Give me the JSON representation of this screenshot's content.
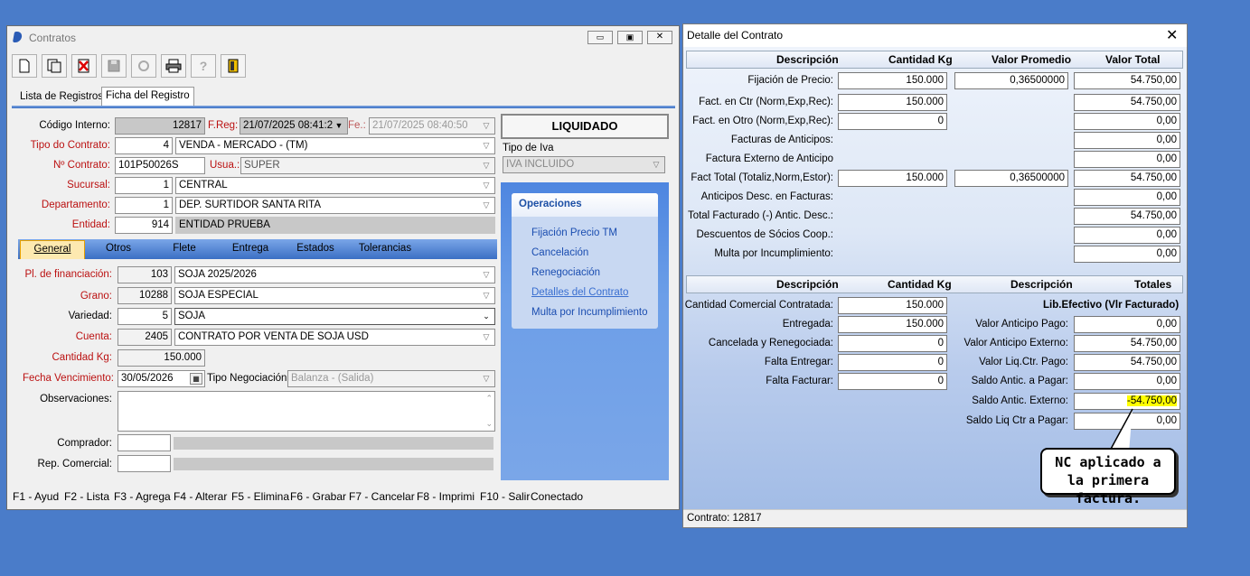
{
  "contratos": {
    "title": "Contratos",
    "tabs": [
      "Lista de Registros",
      "Ficha del Registro"
    ],
    "labels": {
      "codigo": "Código Interno:",
      "freg": "F.Reg:",
      "fe": "Fe.:",
      "tipo_contrato": "Tipo do Contrato:",
      "nro_contrato": "Nº Contrato:",
      "usua": "Usua.:",
      "sucursal": "Sucursal:",
      "departamento": "Departamento:",
      "entidad": "Entidad:",
      "tipo_iva": "Tipo de Iva"
    },
    "values": {
      "codigo": "12817",
      "freg": "21/07/2025 08:41:2",
      "fe": "21/07/2025 08:40:50",
      "tipo_contrato_code": "4",
      "tipo_contrato": "VENDA - MERCADO - (TM)",
      "nro_contrato": "101P50026S",
      "usua": "SUPER",
      "sucursal_code": "1",
      "sucursal": "CENTRAL",
      "departamento_code": "1",
      "departamento": "DEP. SURTIDOR SANTA RITA",
      "entidad_code": "914",
      "entidad": "ENTIDAD PRUEBA",
      "status": "LIQUIDADO",
      "tipo_iva": "IVA INCLUIDO"
    },
    "subtabs": [
      "General",
      "Otros",
      "Flete",
      "Entrega",
      "Estados",
      "Tolerancias"
    ],
    "general": {
      "labels": {
        "pl_fin": "Pl. de financiación:",
        "grano": "Grano:",
        "variedad": "Variedad:",
        "cuenta": "Cuenta:",
        "cantidad": "Cantidad Kg:",
        "fecha_venc": "Fecha Vencimiento:",
        "tipo_neg": "Tipo Negociación:",
        "obs": "Observaciones:",
        "comprador": "Comprador:",
        "rep": "Rep. Comercial:"
      },
      "values": {
        "pl_fin_code": "103",
        "pl_fin": "SOJA 2025/2026",
        "grano_code": "10288",
        "grano": "SOJA ESPECIAL",
        "variedad_code": "5",
        "variedad": "SOJA",
        "cuenta_code": "2405",
        "cuenta": "CONTRATO POR VENTA DE SOJA USD",
        "cantidad": "150.000",
        "fecha_venc": "30/05/2026",
        "tipo_neg": "Balanza - (Salida)"
      }
    },
    "operaciones": {
      "title": "Operaciones",
      "items": [
        "Fijación Precio TM",
        "Cancelación",
        "Renegociación",
        "Detalles del Contrato",
        "Multa por Incumplimiento"
      ]
    },
    "statusbar": [
      "F1 - Ayud",
      "F2 - Lista",
      "F3 - Agrega",
      "F4 - Alterar",
      "F5 - Elimina",
      "F6 - Grabar",
      "F7 - Cancelar",
      "F8 - Imprimi",
      "F10 - Salir",
      "Conectado"
    ]
  },
  "detalle": {
    "title": "Detalle del Contrato",
    "close": "✕",
    "top_headers": [
      "Descripción",
      "Cantidad Kg",
      "Valor Promedio",
      "Valor Total"
    ],
    "top_rows": [
      {
        "label": "Fijación de Precio:",
        "qty": "150.000",
        "avg": "0,36500000",
        "total": "54.750,00"
      },
      {
        "label": "Fact. en Ctr (Norm,Exp,Rec):",
        "qty": "150.000",
        "avg": null,
        "total": "54.750,00"
      },
      {
        "label": "Fact. en Otro (Norm,Exp,Rec):",
        "qty": "0",
        "avg": null,
        "total": "0,00"
      },
      {
        "label": "Facturas de Anticipos:",
        "qty": null,
        "avg": null,
        "total": "0,00"
      },
      {
        "label": "Factura Externo de Anticipo",
        "qty": null,
        "avg": null,
        "total": "0,00"
      },
      {
        "label": "Fact Total (Totaliz,Norm,Estor):",
        "qty": "150.000",
        "avg": "0,36500000",
        "total": "54.750,00"
      },
      {
        "label": "Anticipos Desc. en Facturas:",
        "qty": null,
        "avg": null,
        "total": "0,00"
      },
      {
        "label": "Total Facturado (-) Antic. Desc.:",
        "qty": null,
        "avg": null,
        "total": "54.750,00"
      },
      {
        "label": "Descuentos de Sócios Coop.:",
        "qty": null,
        "avg": null,
        "total": "0,00"
      },
      {
        "label": "Multa por Incumplimiento:",
        "qty": null,
        "avg": null,
        "total": "0,00"
      }
    ],
    "bottom_headers": [
      "Descripción",
      "Cantidad Kg",
      "Descripción",
      "Totales"
    ],
    "bottom_left": [
      {
        "label": "Cantidad Comercial Contratada:",
        "qty": "150.000"
      },
      {
        "label": "Entregada:",
        "qty": "150.000"
      },
      {
        "label": "Cancelada y Renegociada:",
        "qty": "0"
      },
      {
        "label": "Falta Entregar:",
        "qty": "0"
      },
      {
        "label": "Falta Facturar:",
        "qty": "0"
      }
    ],
    "lib_title": "Lib.Efectivo (Vlr Facturado)",
    "bottom_right": [
      {
        "label": "Valor Anticipo Pago:",
        "value": "0,00"
      },
      {
        "label": "Valor Anticipo Externo:",
        "value": "54.750,00"
      },
      {
        "label": "Valor Liq.Ctr. Pago:",
        "value": "54.750,00"
      },
      {
        "label": "Saldo Antic. a Pagar:",
        "value": "0,00"
      },
      {
        "label": "Saldo Antic. Externo:",
        "value": "-54.750,00"
      },
      {
        "label": "Saldo Liq Ctr a Pagar:",
        "value": "0,00"
      }
    ],
    "callout": "NC aplicado a la primera factura.",
    "status": "Contrato: 12817",
    "highlight_color": "#ffff00"
  }
}
